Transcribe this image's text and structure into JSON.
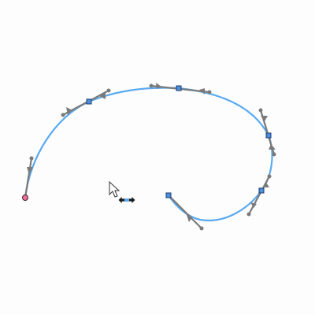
{
  "colors": {
    "background": "#fdfdfd",
    "curve": "#5aaaf0",
    "handle": "#7a7a7a",
    "node": "#4a90e2",
    "start_node": "#e8729a",
    "cursor_fill": "#ffffff",
    "cursor_stroke": "#333333"
  },
  "editor": {
    "segment_count": 6,
    "handle_count": 12
  },
  "icons": {
    "pointer": "arrow-pointer-icon",
    "move_horizontal": "horizontal-move-icon"
  }
}
